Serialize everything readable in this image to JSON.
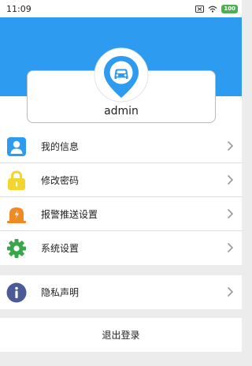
{
  "status_bar": {
    "time": "11:09",
    "battery": "100"
  },
  "profile": {
    "username": "admin"
  },
  "menu_group_1": [
    {
      "label": "我的信息",
      "icon": "user-icon",
      "color": "#2d9bf0"
    },
    {
      "label": "修改密码",
      "icon": "lock-icon",
      "color": "#f4d530"
    },
    {
      "label": "报警推送设置",
      "icon": "alarm-icon",
      "color": "#f08a24"
    },
    {
      "label": "系统设置",
      "icon": "gear-icon",
      "color": "#3aa64a"
    }
  ],
  "menu_group_2": [
    {
      "label": "隐私声明",
      "icon": "info-icon",
      "color": "#4b5b96"
    }
  ],
  "logout": {
    "label": "退出登录"
  },
  "colors": {
    "header": "#2d9bf0",
    "background": "#ececec"
  }
}
